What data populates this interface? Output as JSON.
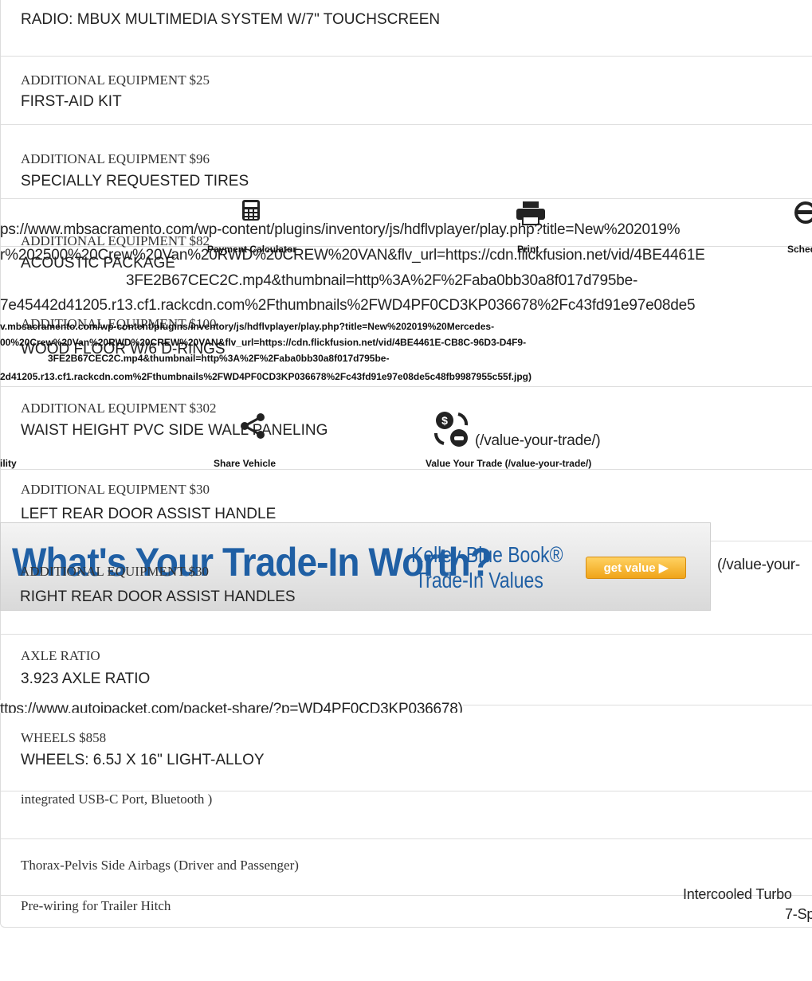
{
  "rows": [
    {
      "category": "",
      "value": "RADIO: MBUX MULTIMEDIA SYSTEM W/7\" TOUCHSCREEN"
    },
    {
      "category": "ADDITIONAL EQUIPMENT $25",
      "value": "FIRST-AID KIT"
    },
    {
      "category": "ADDITIONAL EQUIPMENT $96",
      "value": "SPECIALLY REQUESTED TIRES"
    },
    {
      "category": "ADDITIONAL EQUIPMENT $82",
      "value": "ACOUSTIC PACKAGE"
    },
    {
      "category": "ADDITIONAL EQUIPMENT $100",
      "value": "WOOD FLOOR W/6 D-RINGS"
    },
    {
      "category": "ADDITIONAL EQUIPMENT $302",
      "value": "WAIST HEIGHT PVC SIDE WALL PANELING"
    },
    {
      "category": "ADDITIONAL EQUIPMENT $30",
      "value": "LEFT REAR DOOR ASSIST HANDLE"
    },
    {
      "category": "ADDITIONAL EQUIPMENT $30",
      "value": "RIGHT REAR DOOR ASSIST HANDLES"
    },
    {
      "category": "AXLE RATIO",
      "value": "3.923 AXLE RATIO"
    },
    {
      "category": "WHEELS $858",
      "value": "WHEELS: 6.5J X 16\" LIGHT-ALLOY"
    }
  ],
  "features": [
    "integrated USB-C Port, Bluetooth )",
    "Thorax-Pelvis Side Airbags (Driver and Passenger)",
    "Pre-wiring for Trailer Hitch"
  ],
  "overlay": {
    "video_url_lines": [
      "ps://www.mbsacramento.com/wp-content/plugins/inventory/js/hdflvplayer/play.php?title=New%202019%",
      "r%202500%20Crew%20Van%20RWD%20CREW%20VAN&flv_url=https://cdn.flickfusion.net/vid/4BE4461E",
      "3FE2B67CEC2C.mp4&thumbnail=http%3A%2F%2Faba0bb30a8f017d795be-",
      "7e45442d41205.r13.cf1.rackcdn.com%2Fthumbnails%2FWD4PF0CD3KP036678%2Fc43fd91e97e08de5"
    ],
    "video_url_bold_lines": [
      "v.mbsacramento.com/wp-content/plugins/inventory/js/hdflvplayer/play.php?title=New%202019%20Mercedes-",
      "00%20Crew%20Van%20RWD%20CREW%20VAN&flv_url=https://cdn.flickfusion.net/vid/4BE4461E-CB8C-96D3-D4F9-",
      "3FE2B67CEC2C.mp4&thumbnail=http%3A%2F%2Faba0bb30a8f017d795be-",
      "2d41205.r13.cf1.rackcdn.com%2Fthumbnails%2FWD4PF0CD3KP036678%2Fc43fd91e97e08de5c48fb9987955c55f.jpg)"
    ],
    "payment_calculator_label": "Payment Calculator",
    "print_label": "Print",
    "schedule_label": "Schedule T",
    "availability_label": "ility",
    "share_vehicle_label": "Share Vehicle",
    "value_trade_link": "(/value-your-trade/)",
    "value_trade_label": "Value Your Trade (/value-your-trade/)",
    "banner_link_text": "(/value-your-",
    "packet_url": "ttps://www.autoipacket.com/packet-share/?p=WD4PF0CD3KP036678)",
    "engine_line1": "Intercooled Turbo",
    "engine_line2": "7-Sp"
  },
  "banner": {
    "headline": "What's Your Trade-In Worth?",
    "kbb_line1": "Kelley Blue Book®",
    "kbb_line2": "Trade-In Values",
    "button_label": "get value ▶"
  },
  "colors": {
    "banner_blue": "#1f5fa4",
    "button_orange": "#f0a419",
    "divider": "#dedede"
  },
  "icons": [
    "calculator-icon",
    "printer-icon",
    "steering-wheel-icon",
    "share-icon",
    "trade-value-icon"
  ]
}
